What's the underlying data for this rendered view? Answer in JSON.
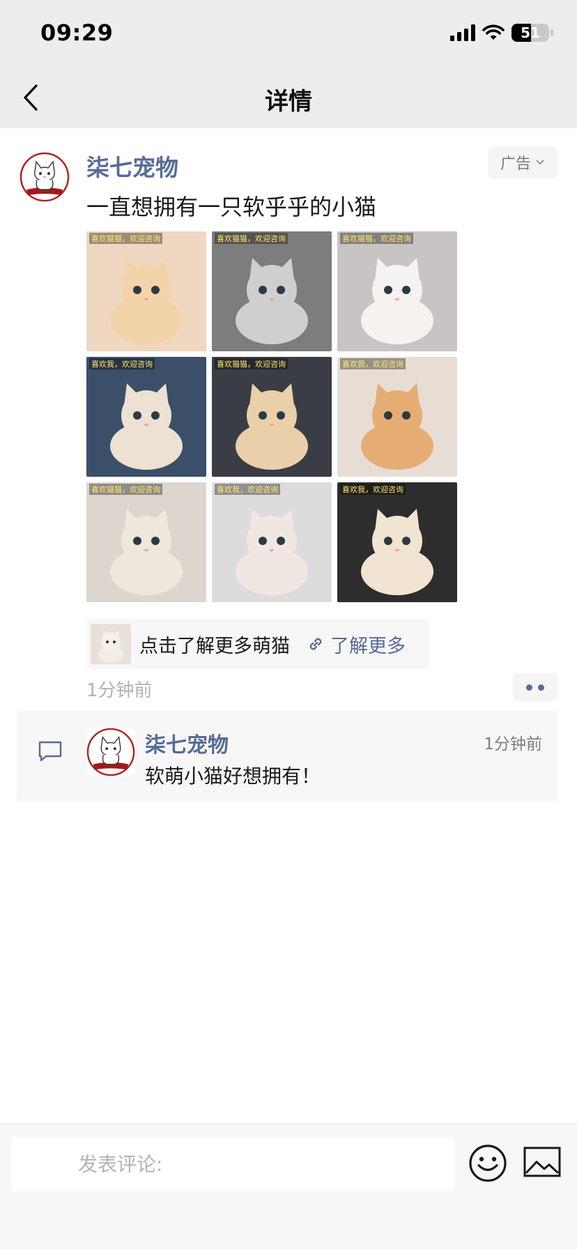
{
  "status_bar": {
    "time": "09:29",
    "battery": "51",
    "battery_level": 0.51
  },
  "nav": {
    "title": "详情"
  },
  "post": {
    "author": "柒七宠物",
    "ad_label": "广告",
    "text": "一直想拥有一只软乎乎的小猫",
    "photos": [
      {
        "caption": "喜欢猫猫，欢迎咨询",
        "bg": "#efd7c1",
        "cat": "#f3d3aa"
      },
      {
        "caption": "喜欢猫猫，欢迎咨询",
        "bg": "#7d7d7d",
        "cat": "#cfcfcf"
      },
      {
        "caption": "喜欢猫猫，欢迎咨询",
        "bg": "#c9c4c4",
        "cat": "#f6f2ef"
      },
      {
        "caption": "喜欢我，欢迎咨询",
        "bg": "#3b4f68",
        "cat": "#ece1d3"
      },
      {
        "caption": "喜欢猫猫，欢迎咨询",
        "bg": "#3a3d45",
        "cat": "#e9d0aa"
      },
      {
        "caption": "喜欢我，欢迎咨询",
        "bg": "#e8ddd5",
        "cat": "#e5ad73"
      },
      {
        "caption": "喜欢猫猫，欢迎咨询",
        "bg": "#dcd6cf",
        "cat": "#efe6dd"
      },
      {
        "caption": "喜欢我，欢迎咨询",
        "bg": "#dcdcdc",
        "cat": "#f1e7e2"
      },
      {
        "caption": "喜欢我，欢迎咨询",
        "bg": "#2d2d2d",
        "cat": "#f2e4d2"
      }
    ],
    "link": {
      "text": "点击了解更多萌猫",
      "action": "了解更多"
    },
    "time": "1分钟前"
  },
  "comment": {
    "author": "柒七宠物",
    "time": "1分钟前",
    "text": "软萌小猫好想拥有！"
  },
  "bottom": {
    "placeholder": "发表评论:"
  }
}
